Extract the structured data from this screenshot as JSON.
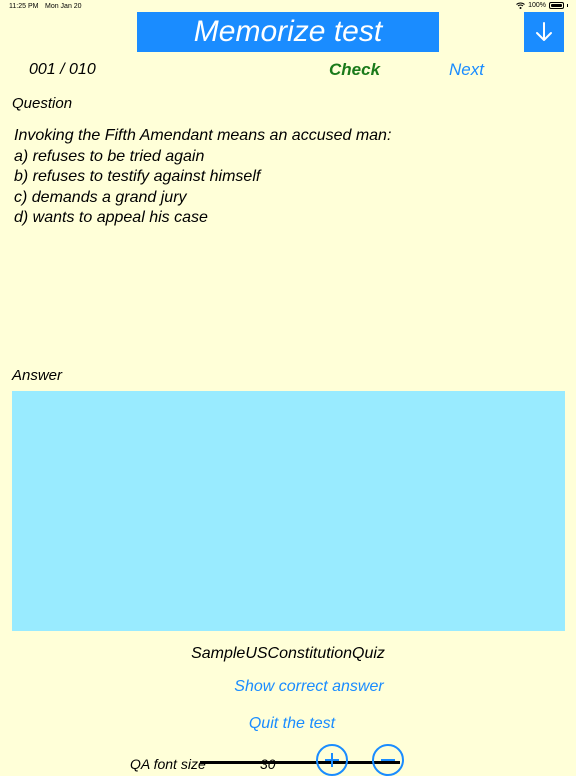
{
  "status_bar": {
    "time": "11:25 PM",
    "date": "Mon Jan 20",
    "battery": "100%"
  },
  "header": {
    "title": "Memorize test",
    "down_icon": "arrow-down-icon"
  },
  "nav": {
    "counter": "001 / 010",
    "check_label": "Check",
    "next_label": "Next"
  },
  "question": {
    "label": "Question",
    "lines": [
      "Invoking the Fifth Amendant means an accused man:",
      "a) refuses to be tried again",
      "b) refuses to testify against himself",
      "c) demands a grand jury",
      "d) wants to appeal his case"
    ]
  },
  "answer": {
    "label": "Answer",
    "value": ""
  },
  "footer": {
    "quiz_name": "SampleUSConstitutionQuiz",
    "show_answer_label": "Show correct answer",
    "quit_label": "Quit the test",
    "font_size_label": "QA font size",
    "font_size_value": "30"
  },
  "colors": {
    "background": "#ffffd8",
    "accent": "#1a8cff",
    "check": "#1a7a1a",
    "answer_area": "#99ebff"
  }
}
